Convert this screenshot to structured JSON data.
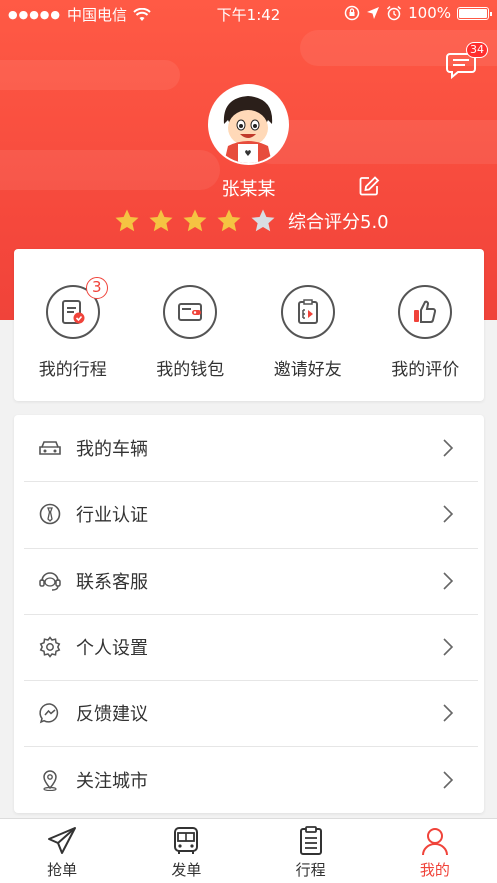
{
  "status_bar": {
    "signal": "●●●●●",
    "carrier": "中国电信",
    "time": "下午1:42",
    "battery": "100%"
  },
  "header": {
    "message_badge": "34",
    "user_name": "张某某",
    "rating_text": "综合评分5.0",
    "stars_filled": 4,
    "stars_total": 5
  },
  "quick_actions": [
    {
      "label": "我的行程",
      "icon": "trip-document-icon",
      "badge": "3"
    },
    {
      "label": "我的钱包",
      "icon": "wallet-icon"
    },
    {
      "label": "邀请好友",
      "icon": "invite-friend-icon"
    },
    {
      "label": "我的评价",
      "icon": "thumbs-up-icon"
    }
  ],
  "menu": [
    {
      "label": "我的车辆",
      "icon": "car-icon"
    },
    {
      "label": "行业认证",
      "icon": "certification-icon"
    },
    {
      "label": "联系客服",
      "icon": "customer-service-icon"
    },
    {
      "label": "个人设置",
      "icon": "gear-icon"
    },
    {
      "label": "反馈建议",
      "icon": "feedback-icon"
    },
    {
      "label": "关注城市",
      "icon": "location-pin-icon"
    }
  ],
  "tabs": [
    {
      "label": "抢单",
      "icon": "paper-plane-icon"
    },
    {
      "label": "发单",
      "icon": "bus-icon"
    },
    {
      "label": "行程",
      "icon": "clipboard-icon"
    },
    {
      "label": "我的",
      "icon": "person-icon",
      "active": true
    }
  ],
  "colors": {
    "accent": "#f0433a",
    "header_top": "#ff5a45",
    "star_filled": "#f5c342",
    "star_empty": "#d8dde3"
  }
}
